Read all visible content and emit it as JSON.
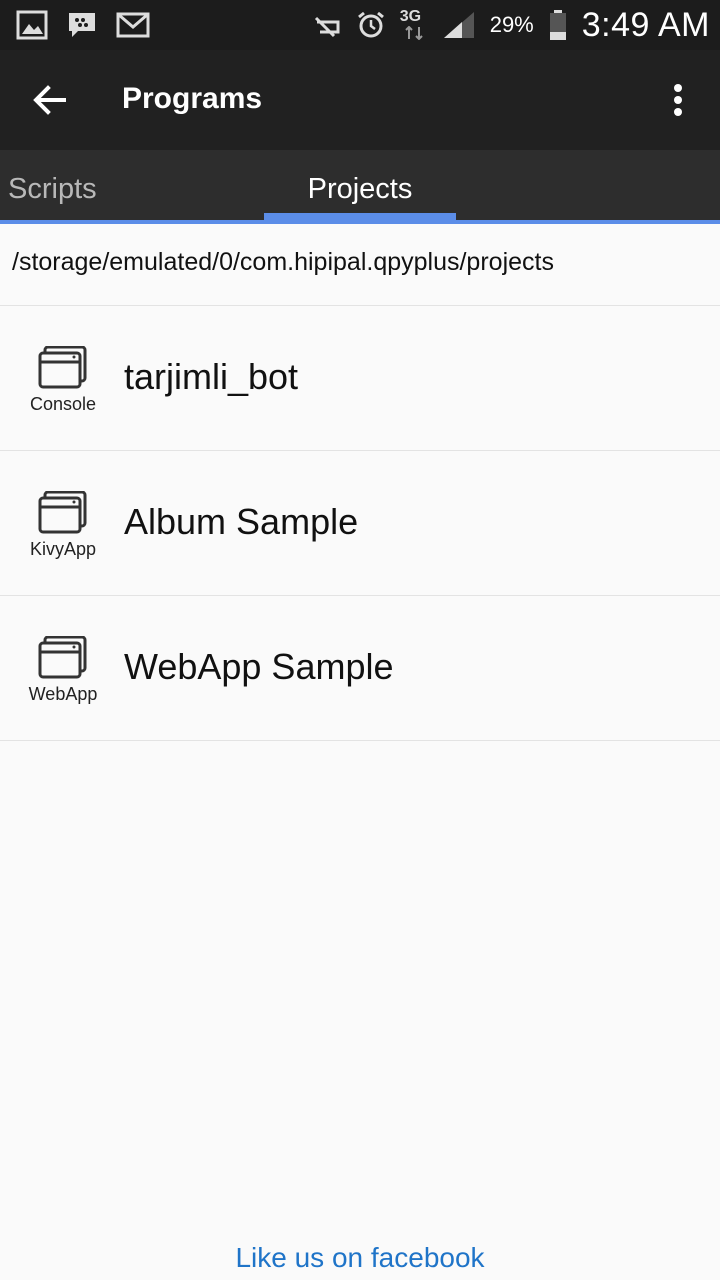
{
  "status_bar": {
    "icons_left": [
      "gallery-icon",
      "messenger-icon",
      "gmail-icon"
    ],
    "icons_right": [
      "mute-icon",
      "alarm-icon",
      "network-3g-icon",
      "signal-icon"
    ],
    "network": "3G",
    "battery": "29%",
    "time": "3:49 AM"
  },
  "toolbar": {
    "back_icon": "arrow-left-icon",
    "title": "Programs",
    "menu_icon": "more-vertical-icon"
  },
  "tabs": [
    {
      "label": "Scripts",
      "active": false
    },
    {
      "label": "Projects",
      "active": true
    }
  ],
  "accent_color": "#5b8de8",
  "path": "/storage/emulated/0/com.hipipal.qpyplus/projects",
  "projects": [
    {
      "type": "Console",
      "name": "tarjimli_bot"
    },
    {
      "type": "KivyApp",
      "name": "Album Sample"
    },
    {
      "type": "WebApp",
      "name": "WebApp Sample"
    }
  ],
  "footer": {
    "link": "Like us on facebook",
    "color": "#1f74c8"
  }
}
